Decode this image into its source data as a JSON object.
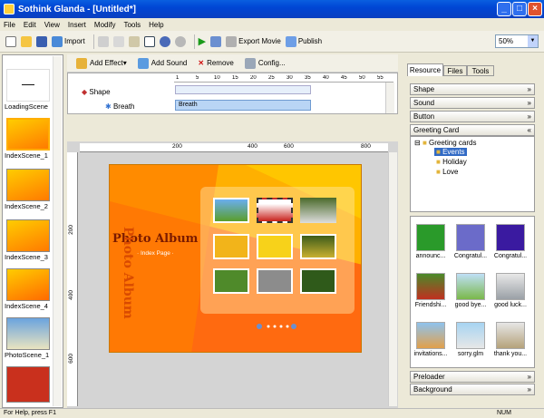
{
  "window": {
    "title": "Sothink Glanda - [Untitled*]",
    "min": "_",
    "max": "□",
    "close": "×"
  },
  "menu": [
    "File",
    "Edit",
    "View",
    "Insert",
    "Modify",
    "Tools",
    "Help"
  ],
  "toolbar": {
    "import": "Import",
    "export": "Export Movie",
    "publish": "Publish",
    "zoom": "50%"
  },
  "scenes": [
    {
      "label": "LoadingScene",
      "color": "#ffffff"
    },
    {
      "label": "IndexScene_1",
      "color": "#ff9a00"
    },
    {
      "label": "IndexScene_2",
      "color": "#ff9a00"
    },
    {
      "label": "IndexScene_3",
      "color": "#ff9a00"
    },
    {
      "label": "IndexScene_4",
      "color": "#ff9a00"
    },
    {
      "label": "PhotoScene_1",
      "color": "#4d8ec9"
    },
    {
      "label": "",
      "color": "#c9301d"
    }
  ],
  "effectbar": {
    "add_effect": "Add Effect",
    "add_sound": "Add Sound",
    "remove": "Remove",
    "config": "Config..."
  },
  "timeline": {
    "ruler": [
      "1",
      "5",
      "10",
      "15",
      "20",
      "25",
      "30",
      "35",
      "40",
      "45",
      "50",
      "55",
      "60",
      "65"
    ],
    "layer": "Shape",
    "effect": "Breath",
    "bar": "Breath"
  },
  "rulers": {
    "h": [
      "200",
      "400",
      "600",
      "800"
    ],
    "v": [
      "200",
      "400",
      "600"
    ]
  },
  "stage": {
    "title": "Photo Album",
    "subtitle": "· Index Page ·",
    "vertical": "Photo Album"
  },
  "panel": {
    "tabs": [
      "Resource",
      "Files",
      "Tools"
    ],
    "sections": [
      "Shape",
      "Sound",
      "Button",
      "Greeting Card"
    ],
    "tree": {
      "root": "Greeting cards",
      "items": [
        "Events",
        "Holiday",
        "Love"
      ]
    },
    "gallery": [
      "announc...",
      "Congratul...",
      "Congratul...",
      "Friendshi...",
      "good bye...",
      "good luck...",
      "invitations...",
      "sorry.glm",
      "thank you..."
    ],
    "bottom": [
      "Preloader",
      "Background"
    ]
  },
  "status": {
    "left": "For Help, press F1",
    "right": "NUM"
  }
}
